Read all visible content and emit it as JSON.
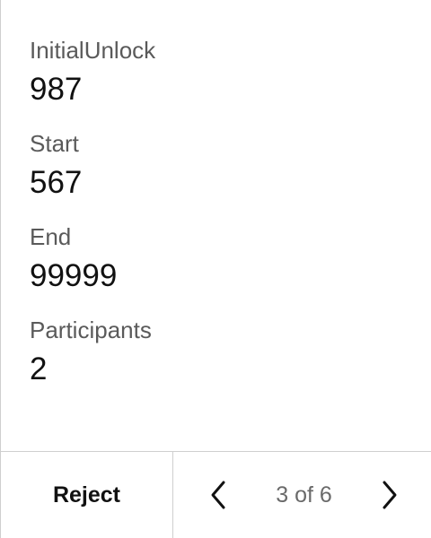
{
  "fields": [
    {
      "label": "InitialUnlock",
      "value": "987"
    },
    {
      "label": "Start",
      "value": "567"
    },
    {
      "label": "End",
      "value": "99999"
    },
    {
      "label": "Participants",
      "value": "2"
    }
  ],
  "footer": {
    "reject_label": "Reject",
    "page_text": "3 of 6",
    "prev_icon": "chevron-left-icon",
    "next_icon": "chevron-right-icon"
  }
}
